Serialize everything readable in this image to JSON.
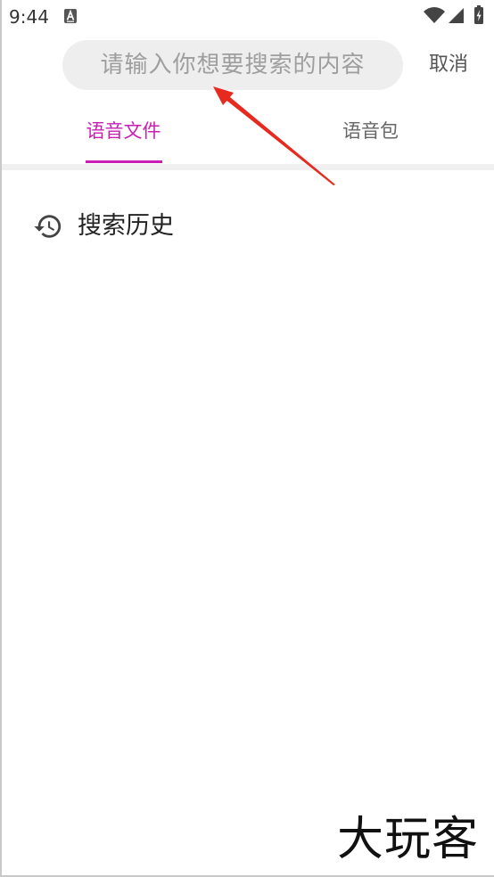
{
  "status_bar": {
    "time": "9:44",
    "icons": [
      "a-notification-icon",
      "wifi-icon",
      "signal-icon",
      "battery-charging-icon"
    ]
  },
  "search": {
    "placeholder": "请输入你想要搜索的内容",
    "value": "",
    "cancel_label": "取消"
  },
  "tabs": [
    {
      "label": "语音文件",
      "active": true
    },
    {
      "label": "语音包",
      "active": false
    }
  ],
  "history": {
    "icon": "history-icon",
    "title": "搜索历史"
  },
  "annotation": {
    "icon": "red-arrow-icon"
  },
  "watermark": {
    "text": "大玩客"
  },
  "colors": {
    "accent": "#c81eb4",
    "annotation_arrow": "#e62a1f",
    "search_background": "#eeeeee",
    "divider": "#f0f0f0"
  }
}
